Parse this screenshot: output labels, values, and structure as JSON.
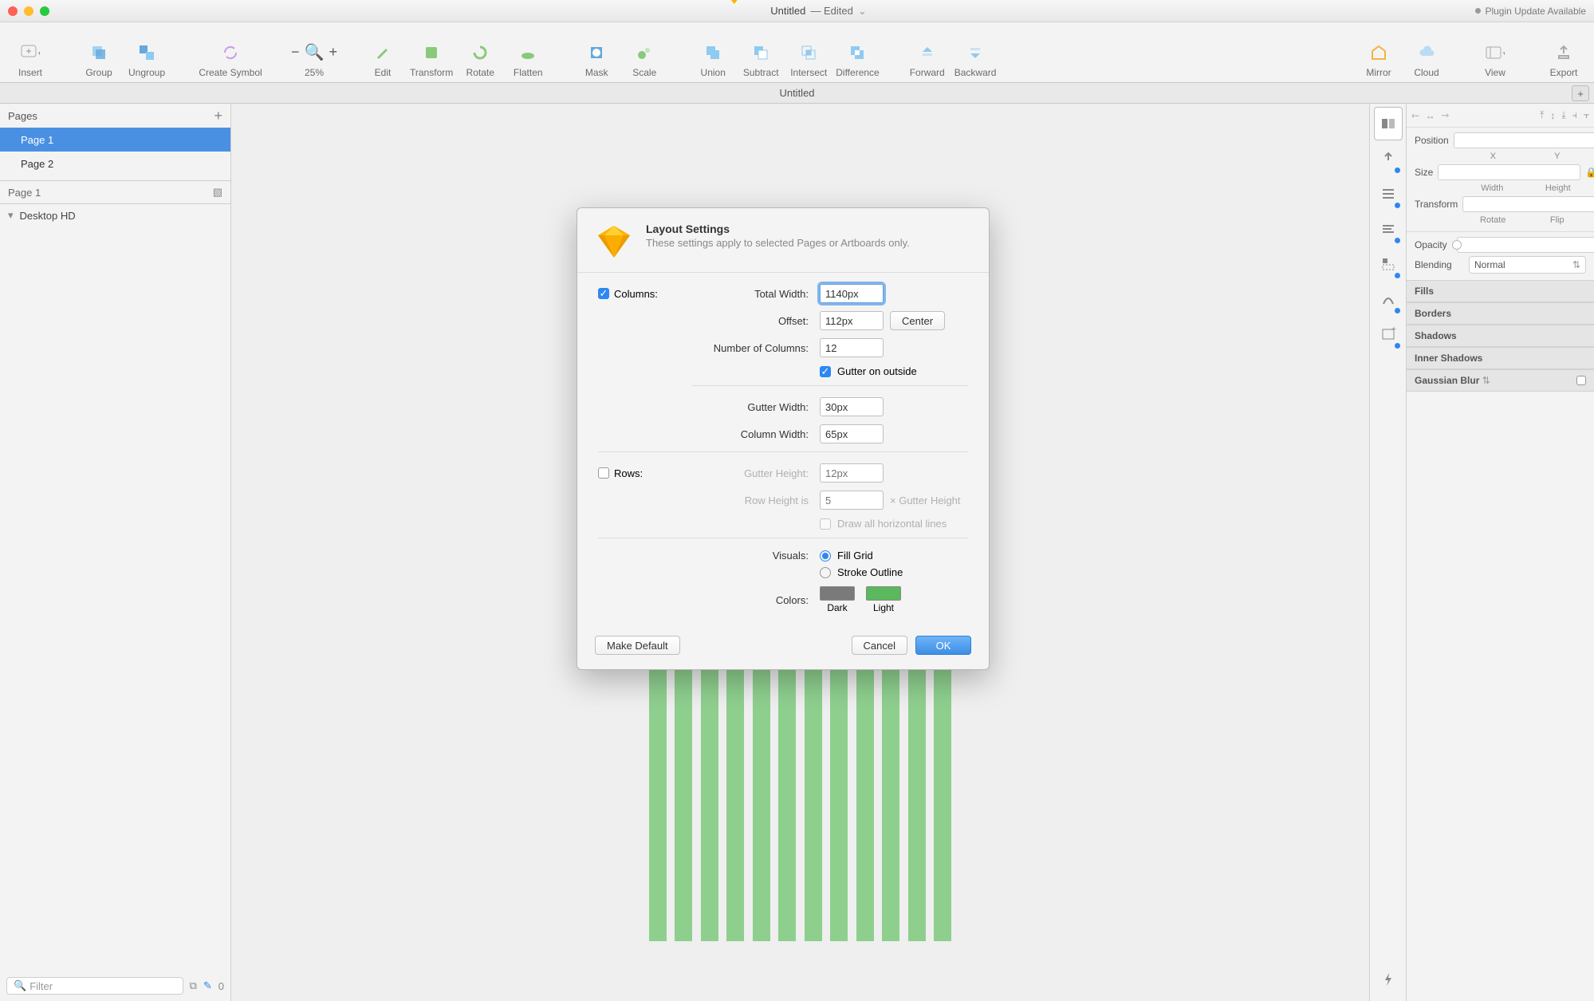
{
  "titlebar": {
    "doc_name": "Untitled",
    "edited": "— Edited",
    "plugin_notice": "Plugin Update Available"
  },
  "toolbar": {
    "insert": "Insert",
    "group": "Group",
    "ungroup": "Ungroup",
    "create_symbol": "Create Symbol",
    "zoom_pct": "25%",
    "edit": "Edit",
    "transform": "Transform",
    "rotate": "Rotate",
    "flatten": "Flatten",
    "mask": "Mask",
    "scale": "Scale",
    "union": "Union",
    "subtract": "Subtract",
    "intersect": "Intersect",
    "difference": "Difference",
    "forward": "Forward",
    "backward": "Backward",
    "mirror": "Mirror",
    "cloud": "Cloud",
    "view": "View",
    "export": "Export"
  },
  "doc_tab": "Untitled",
  "left": {
    "pages_label": "Pages",
    "page_items": [
      "Page 1",
      "Page 2"
    ],
    "layers_header": "Page 1",
    "layer_item": "Desktop HD",
    "filter_placeholder": "Filter",
    "count": "0"
  },
  "dialog": {
    "title": "Layout Settings",
    "subtitle": "These settings apply to selected Pages or Artboards only.",
    "columns_label": "Columns:",
    "rows_label": "Rows:",
    "total_width_label": "Total Width:",
    "total_width_value": "1140px",
    "offset_label": "Offset:",
    "offset_value": "112px",
    "center_btn": "Center",
    "num_cols_label": "Number of Columns:",
    "num_cols_value": "12",
    "gutter_outside_label": "Gutter on outside",
    "gutter_width_label": "Gutter Width:",
    "gutter_width_value": "30px",
    "column_width_label": "Column Width:",
    "column_width_value": "65px",
    "gutter_height_label": "Gutter Height:",
    "gutter_height_placeholder": "12px",
    "row_height_label": "Row Height is",
    "row_height_placeholder": "5",
    "row_height_suffix": "× Gutter Height",
    "draw_horiz_label": "Draw all horizontal lines",
    "visuals_label": "Visuals:",
    "fill_grid": "Fill Grid",
    "stroke_outline": "Stroke Outline",
    "colors_label": "Colors:",
    "dark_label": "Dark",
    "light_label": "Light",
    "make_default": "Make Default",
    "cancel": "Cancel",
    "ok": "OK",
    "dark_color": "#7a7a7a",
    "light_color": "#5cb85c"
  },
  "inspector": {
    "position": "Position",
    "x": "X",
    "y": "Y",
    "size": "Size",
    "width": "Width",
    "height": "Height",
    "transform": "Transform",
    "rotate": "Rotate",
    "flip": "Flip",
    "opacity": "Opacity",
    "blending": "Blending",
    "blend_value": "Normal",
    "fills": "Fills",
    "borders": "Borders",
    "shadows": "Shadows",
    "inner_shadows": "Inner Shadows",
    "gaussian_blur": "Gaussian Blur"
  }
}
